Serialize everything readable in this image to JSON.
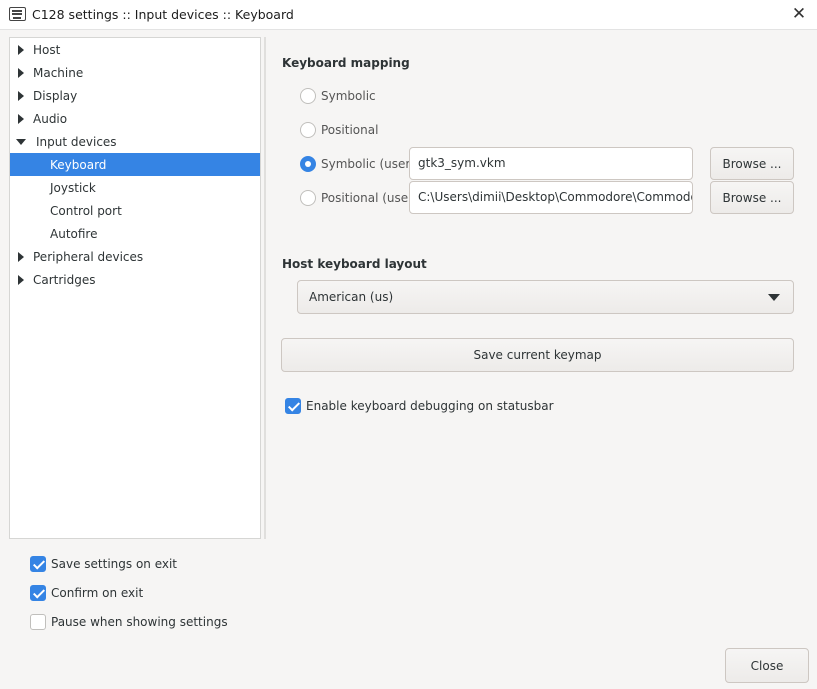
{
  "window": {
    "title": "C128 settings :: Input devices :: Keyboard"
  },
  "tree": {
    "items": [
      {
        "label": "Host",
        "expander": "collapsed"
      },
      {
        "label": "Machine",
        "expander": "collapsed"
      },
      {
        "label": "Display",
        "expander": "collapsed"
      },
      {
        "label": "Audio",
        "expander": "collapsed"
      },
      {
        "label": "Input devices",
        "expander": "expanded"
      },
      {
        "label": "Keyboard",
        "selected": true
      },
      {
        "label": "Joystick"
      },
      {
        "label": "Control port"
      },
      {
        "label": "Autofire"
      },
      {
        "label": "Peripheral devices",
        "expander": "collapsed"
      },
      {
        "label": "Cartridges",
        "expander": "collapsed"
      }
    ]
  },
  "keyboard_mapping": {
    "title": "Keyboard mapping",
    "options": [
      {
        "label": "Symbolic",
        "checked": false
      },
      {
        "label": "Positional",
        "checked": false
      },
      {
        "label": "Symbolic (user)",
        "checked": true,
        "file": "gtk3_sym.vkm",
        "browse": "Browse ..."
      },
      {
        "label": "Positional (user)",
        "checked": false,
        "file": "C:\\Users\\dimii\\Desktop\\Commodore\\Commodore I",
        "browse": "Browse ..."
      }
    ]
  },
  "host_layout": {
    "title": "Host keyboard layout",
    "selected": "American (us)"
  },
  "save_keymap_label": "Save current keymap",
  "debug_checkbox": {
    "label": "Enable keyboard debugging on statusbar",
    "checked": true
  },
  "footer": {
    "save_on_exit": {
      "label": "Save settings on exit",
      "checked": true
    },
    "confirm_on_exit": {
      "label": "Confirm on exit",
      "checked": true
    },
    "pause_when_showing": {
      "label": "Pause when showing settings",
      "checked": false
    },
    "close_label": "Close"
  },
  "colors": {
    "accent": "#3584e4",
    "window_bg": "#f6f5f4"
  }
}
